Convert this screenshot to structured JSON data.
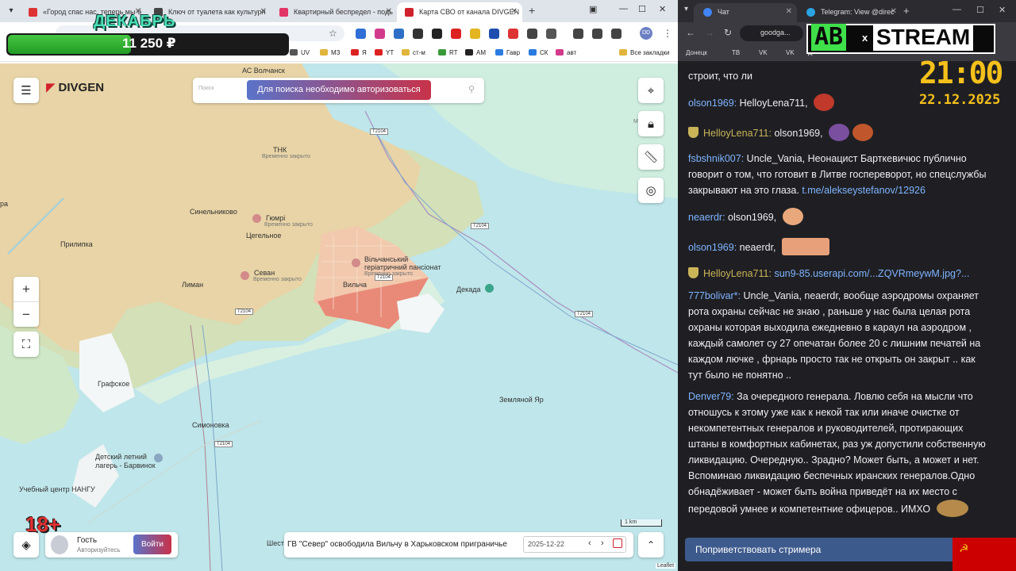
{
  "left_browser": {
    "tabs": [
      {
        "label": "«Город спас нас, теперь мы б",
        "favicon_color": "#d33"
      },
      {
        "label": "Ключ от туалета как культурн",
        "favicon_color": "#444"
      },
      {
        "label": "Квартирный беспредел - подь",
        "favicon_color": "#e33466"
      },
      {
        "label": "Карта СВО от канала DIVGEN",
        "favicon_color": "#d0222d"
      }
    ],
    "bookmarks": [
      "UV",
      "МЗ",
      "Я",
      "YT",
      "ст-м",
      "RT",
      "AM",
      "Гавр",
      "СК",
      "авт",
      "Все закладки"
    ],
    "ext_profile": "DD"
  },
  "overlay": {
    "month": "ДЕКАБРЬ",
    "donation_amount": "11 250 ₽",
    "donation_progress": 0.44,
    "age_rating": "18+"
  },
  "map": {
    "logo": "DIVGEN",
    "search_placeholder": "Поиск",
    "search_message": "Для поиска необходимо авторизоваться",
    "labels": {
      "ac_volchansk": "АС Волчанск",
      "tnk": "ТНК",
      "tnk_sub": "Временно закрыто",
      "sinelnikovo": "Синельниково",
      "gyumri": "Гюмрі",
      "gyumri_sub": "Временно закрыто",
      "tsegelnoe": "Цегельное",
      "prilipka": "Прилипка",
      "liman": "Лиман",
      "sevan": "Севан",
      "sevan_sub": "Временно закрыто",
      "vilcha": "Вильча",
      "pansionat": "Вільчанський геріатричний пансіонат",
      "pansionat_sub": "Временно закрыто",
      "dekada": "Декада",
      "grafskoe": "Графское",
      "zemlyanoy_yar": "Земляной Яр",
      "simonovka": "Симоновка",
      "camp": "Детский летний лагерь - Барвинок",
      "training": "Учебный центр НАНГУ",
      "shest": "Шест",
      "m_label": "М",
      "ra": "ра"
    },
    "roads": [
      "T2104",
      "T2104",
      "T2104",
      "T2104",
      "T2104",
      "T2104"
    ],
    "zoom_in": "+",
    "zoom_out": "−",
    "guest_name": "Гость",
    "guest_sub": "Авторизуйтесь",
    "login": "Войти",
    "news": "ГВ \"Север\" освободила Вильчу в Харьковском приграничье",
    "date": "2025-12-22",
    "scale": "1 km",
    "attribution": "Leaflet"
  },
  "right_browser": {
    "tabs": [
      {
        "label": "Чат",
        "favicon_color": "#4285f4"
      },
      {
        "label": "Telegram: View @direc",
        "favicon_color": "#2aa3e0"
      }
    ],
    "url": "goodga...",
    "bookmarks": [
      "Донецк",
      "ТВ",
      "VK",
      "VK",
      "Д"
    ]
  },
  "stream_overlay": {
    "logo_left": "АВ",
    "logo_x": "x",
    "logo_right": "STREAM",
    "time": "21:00",
    "date": "22.12.2025"
  },
  "chat": {
    "messages": [
      {
        "user": "",
        "text": "строит, что ли"
      },
      {
        "user": "olson1969:",
        "text": "HelloyLena711,"
      },
      {
        "user": "HelloyLena711:",
        "text": "olson1969,"
      },
      {
        "user": "fsbshnik007:",
        "text": "Uncle_Vania, Неонацист Барткевичюс публично говорит о том, что готовит в Литве госпереворот, но спецслужбы закрывают на это глаза.",
        "link": "t.me/alekseystefanov/12926"
      },
      {
        "user": "neaerdr:",
        "text": "olson1969,"
      },
      {
        "user": "olson1969:",
        "text": "neaerdr,"
      },
      {
        "user": "HelloyLena711:",
        "text": "",
        "link": "sun9-85.userapi.com/...ZQVRmeywM.jpg?..."
      },
      {
        "user": "777bolivar*:",
        "text": "Uncle_Vania, neaerdr, вообще аэродромы охраняет рота охраны сейчас не знаю , раньше у нас была целая рота охраны которая выходила ежедневно в караул на аэродром , каждый самолет су 27 опечатан более 20 с лишним печатей на каждом лючке , фрнарь просто так не открыть он закрыт .. как тут было не понятно .."
      },
      {
        "user": "Denver79:",
        "text": "За очередного генерала. Ловлю себя на мысли что отношусь к этому уже как к некой так или иначе очистке от некомпетентных генералов и руководителей, протирающих штаны в комфортных кабинетах, раз уж допустили собственную ликвидацию. Очередную.. Зрадно? Может быть, а может и нет. Вспоминаю ликвидацию беспечных иранских генералов.Одно обнадёживает - может быть война приведёт на их место с передовой умнее и компетентние офицеров.. ИМХО"
      }
    ],
    "greet_button": "Поприветствовать стримера"
  }
}
